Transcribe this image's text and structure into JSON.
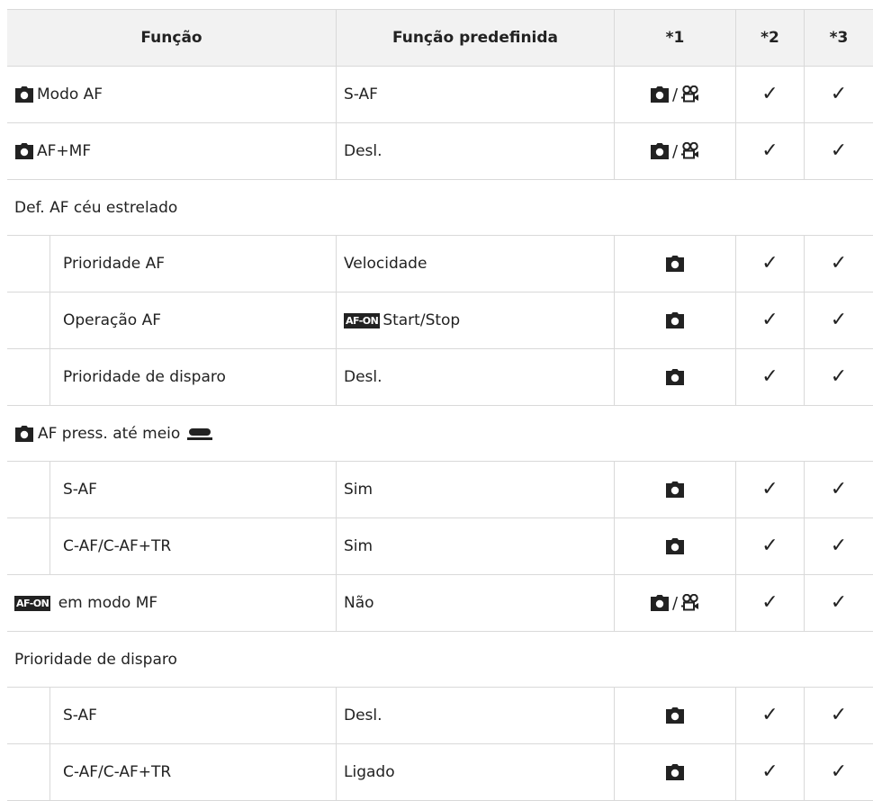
{
  "header": {
    "col1": "Função",
    "col2": "Função predefinida",
    "col3": "*1",
    "col4": "*2",
    "col5": "*3"
  },
  "rows": [
    {
      "type": "data",
      "icon_prefix": "camera-icon",
      "label": "Modo AF",
      "value": "S-AF",
      "mode": "photo-video",
      "c2": "✓",
      "c3": "✓"
    },
    {
      "type": "data",
      "icon_prefix": "camera-icon",
      "label": "AF+MF",
      "value": "Desl.",
      "mode": "photo-video",
      "c2": "✓",
      "c3": "✓"
    },
    {
      "type": "section",
      "label": "Def. AF céu estrelado"
    },
    {
      "type": "sub",
      "label": "Prioridade AF",
      "value": "Velocidade",
      "mode": "photo",
      "c2": "✓",
      "c3": "✓"
    },
    {
      "type": "sub",
      "label": "Operação AF",
      "value_badge": "AF-ON",
      "value": "Start/Stop",
      "mode": "photo",
      "c2": "✓",
      "c3": "✓"
    },
    {
      "type": "sub",
      "label": "Prioridade de disparo",
      "value": "Desl.",
      "mode": "photo",
      "c2": "✓",
      "c3": "✓"
    },
    {
      "type": "section",
      "icon_prefix": "camera-icon",
      "label": "AF press. até meio",
      "icon_suffix": "half-press-shutter-icon"
    },
    {
      "type": "sub",
      "label": "S-AF",
      "value": "Sim",
      "mode": "photo",
      "c2": "✓",
      "c3": "✓"
    },
    {
      "type": "sub",
      "label": "C-AF/C-AF+TR",
      "value": "Sim",
      "mode": "photo",
      "c2": "✓",
      "c3": "✓"
    },
    {
      "type": "data",
      "badge": "AF-ON",
      "label": "em modo MF",
      "value": "Não",
      "mode": "photo-video",
      "c2": "✓",
      "c3": "✓"
    },
    {
      "type": "section",
      "label": "Prioridade de disparo"
    },
    {
      "type": "sub",
      "label": "S-AF",
      "value": "Desl.",
      "mode": "photo",
      "c2": "✓",
      "c3": "✓"
    },
    {
      "type": "sub",
      "label": "C-AF/C-AF+TR",
      "value": "Ligado",
      "mode": "photo",
      "c2": "✓",
      "c3": "✓"
    }
  ],
  "symbols": {
    "slash": "/"
  }
}
